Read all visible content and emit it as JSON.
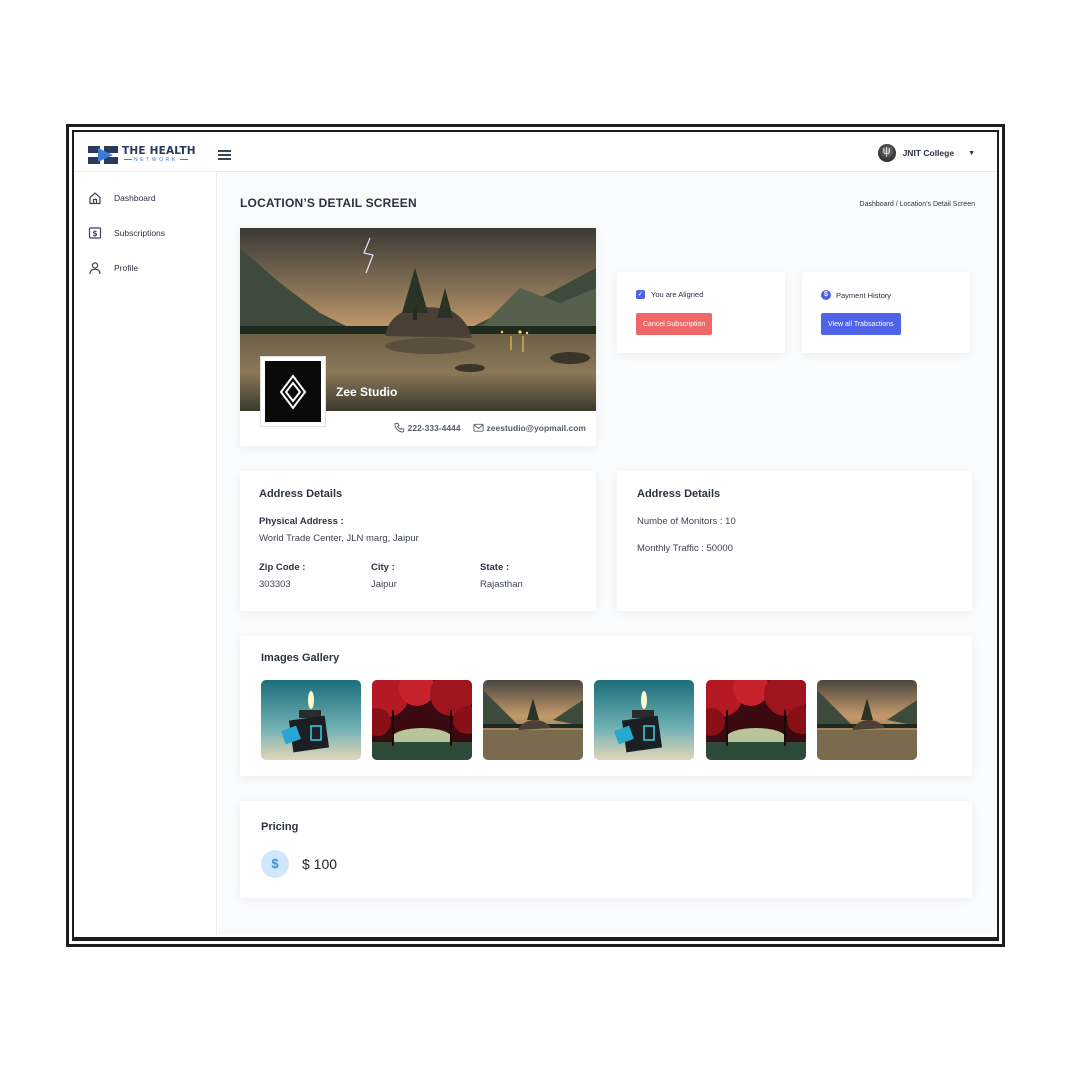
{
  "brand": {
    "title": "THE HEALTH",
    "subtitle": "NETWORK",
    "logo_icon": "play-logo-icon",
    "colors": {
      "navy": "#2a3a5a",
      "blue": "#3a7bd5"
    }
  },
  "header": {
    "menu_icon": "hamburger-icon",
    "user_name": "JNIT College",
    "user_menu_icon": "caret-down-icon"
  },
  "sidebar": {
    "items": [
      {
        "label": "Dashboard",
        "icon": "home-icon"
      },
      {
        "label": "Subscriptions",
        "icon": "dollar-square-icon"
      },
      {
        "label": "Profile",
        "icon": "user-icon"
      }
    ]
  },
  "page": {
    "title": "LOCATION’S DETAIL SCREEN",
    "breadcrumb": "Dashboard / Location’s Detail Screen"
  },
  "profile": {
    "name": "Zee Studio",
    "phone": "222-333-4444",
    "email": "zeestudio@yopmail.com",
    "phone_icon": "phone-icon",
    "email_icon": "mail-icon",
    "cover_image": "mountain-lake-lightning-photo",
    "logo_image": "diamond-logo-icon"
  },
  "status": {
    "aligned_label": "You are Aligned",
    "aligned_checked": true,
    "cancel_button": "Cancel Subscription",
    "payment_label": "Payment History",
    "payment_button": "View all Trabsactions",
    "colors": {
      "primary": "#4f63e8",
      "danger": "#f06767"
    }
  },
  "address_left": {
    "title": "Address Details",
    "physical_label": "Physical Address :",
    "physical_value": "World Trade Center, JLN marg, Jaipur",
    "zip_label": "Zip Code :",
    "zip_value": "303303",
    "city_label": "City :",
    "city_value": "Jaipur",
    "state_label": "State :",
    "state_value": "Rajasthan"
  },
  "address_right": {
    "title": "Address Details",
    "monitors": "Numbe of Monitors : 10",
    "traffic": "Monthly Traffic : 50000"
  },
  "gallery": {
    "title": "Images Gallery",
    "images": [
      "lighter-photo",
      "red-trees-photo",
      "mountain-lake-photo",
      "lighter-photo",
      "red-trees-photo",
      "mountain-lake-photo"
    ]
  },
  "pricing": {
    "title": "Pricing",
    "currency_symbol": "$",
    "amount": "$ 100"
  }
}
